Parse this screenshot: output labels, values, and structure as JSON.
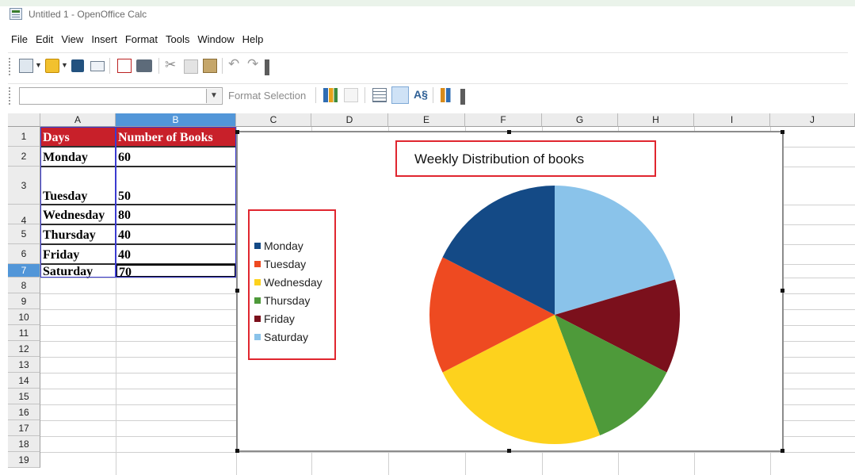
{
  "window": {
    "title": "Untitled 1 - OpenOffice Calc"
  },
  "menu": [
    "File",
    "Edit",
    "View",
    "Insert",
    "Format",
    "Tools",
    "Window",
    "Help"
  ],
  "toolbar2": {
    "format_selection": "Format Selection"
  },
  "columns": [
    "A",
    "B",
    "C",
    "D",
    "E",
    "F",
    "G",
    "H",
    "I",
    "J"
  ],
  "rows": [
    "1",
    "2",
    "3",
    "4",
    "5",
    "6",
    "7",
    "8",
    "9",
    "10",
    "11",
    "12",
    "13",
    "14",
    "15",
    "16",
    "17",
    "18",
    "19"
  ],
  "sheet": {
    "header": [
      "Days",
      "Number of Books"
    ],
    "data": [
      [
        "Monday",
        "60"
      ],
      [
        "Tuesday",
        "50"
      ],
      [
        "Wednesday",
        "80"
      ],
      [
        "Thursday",
        "40"
      ],
      [
        "Friday",
        "40"
      ],
      [
        "Saturday",
        "70"
      ]
    ]
  },
  "chart_data": {
    "type": "pie",
    "title": "Weekly Distribution of books",
    "categories": [
      "Monday",
      "Tuesday",
      "Wednesday",
      "Thursday",
      "Friday",
      "Saturday"
    ],
    "values": [
      60,
      50,
      80,
      40,
      40,
      70
    ],
    "colors": [
      "#144a86",
      "#ee4a21",
      "#fdd21d",
      "#4e9a3a",
      "#7b101c",
      "#8ac3ea"
    ],
    "legend_position": "left"
  },
  "icons": [
    "new-document-icon",
    "open-folder-icon",
    "save-icon",
    "email-icon",
    "export-pdf-icon",
    "print-icon",
    "cut-icon",
    "copy-icon",
    "paste-icon",
    "undo-icon",
    "redo-icon",
    "chart-type-icon",
    "data-table-icon",
    "chart-data-icon",
    "data-ranges-icon",
    "title-icon",
    "chart-wall-icon"
  ]
}
